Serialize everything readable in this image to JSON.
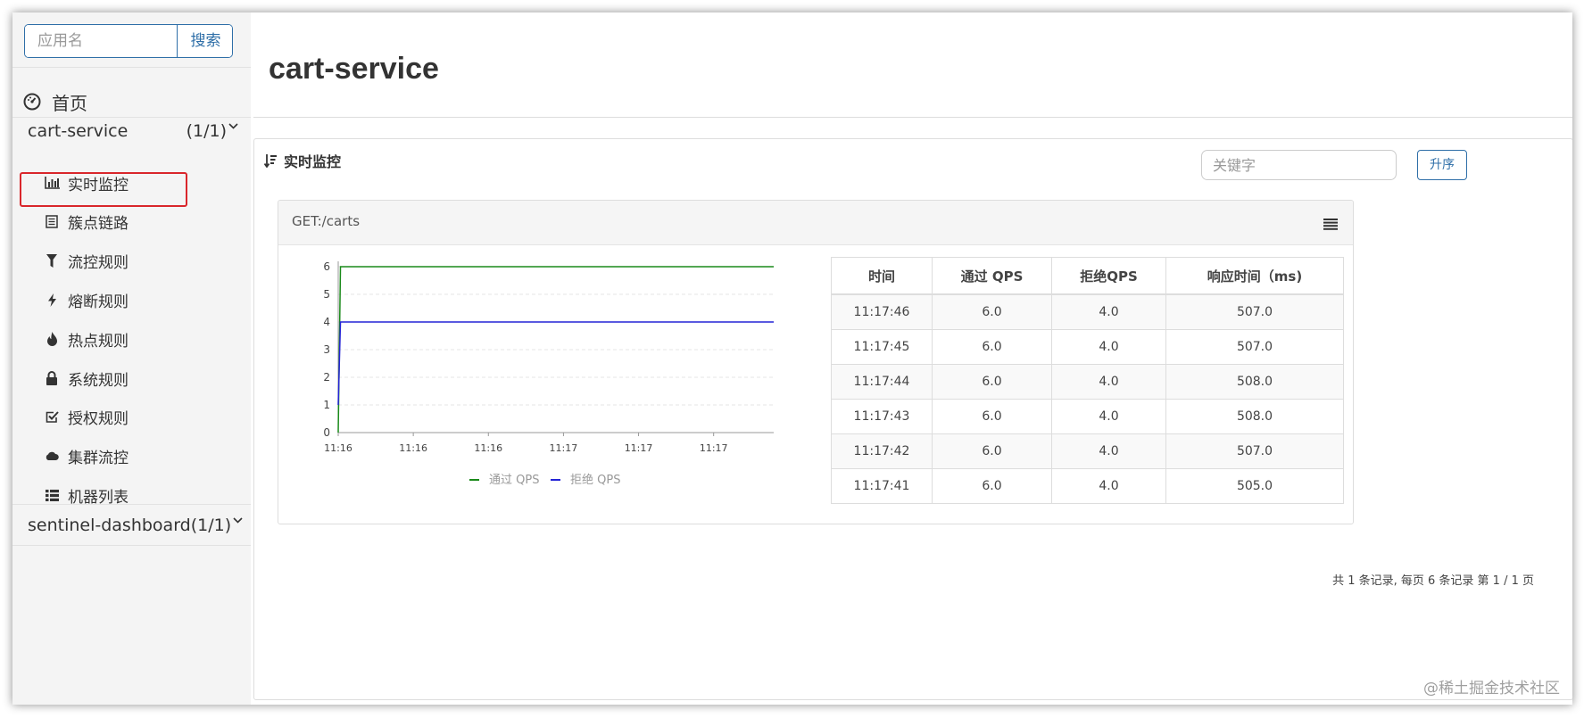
{
  "sidebar": {
    "search": {
      "placeholder": "应用名",
      "button_label": "搜索"
    },
    "home_label": "首页",
    "services": [
      {
        "name": "cart-service",
        "count": "(1/1)",
        "expanded": true,
        "items": [
          {
            "label": "实时监控",
            "icon": "bar-chart-icon",
            "selected": true
          },
          {
            "label": "簇点链路",
            "icon": "list-icon"
          },
          {
            "label": "流控规则",
            "icon": "filter-icon"
          },
          {
            "label": "熔断规则",
            "icon": "flash-icon"
          },
          {
            "label": "热点规则",
            "icon": "fire-icon"
          },
          {
            "label": "系统规则",
            "icon": "lock-icon"
          },
          {
            "label": "授权规则",
            "icon": "check-square-icon"
          },
          {
            "label": "集群流控",
            "icon": "cloud-icon"
          },
          {
            "label": "机器列表",
            "icon": "th-list-icon"
          }
        ]
      },
      {
        "name": "sentinel-dashboard",
        "count": "(1/1)",
        "expanded": false
      }
    ]
  },
  "main": {
    "title": "cart-service",
    "panel": {
      "title": "实时监控",
      "keyword_placeholder": "关键字",
      "sort_button": "升序",
      "resource": {
        "name": "GET:/carts",
        "table": {
          "headers": [
            "时间",
            "通过 QPS",
            "拒绝QPS",
            "响应时间（ms)"
          ],
          "rows": [
            [
              "11:17:46",
              "6.0",
              "4.0",
              "507.0"
            ],
            [
              "11:17:45",
              "6.0",
              "4.0",
              "507.0"
            ],
            [
              "11:17:44",
              "6.0",
              "4.0",
              "508.0"
            ],
            [
              "11:17:43",
              "6.0",
              "4.0",
              "508.0"
            ],
            [
              "11:17:42",
              "6.0",
              "4.0",
              "507.0"
            ],
            [
              "11:17:41",
              "6.0",
              "4.0",
              "505.0"
            ]
          ]
        }
      },
      "pagination": "共 1 条记录, 每页 6 条记录 第 1 / 1 页"
    }
  },
  "watermark": "@稀土掘金技术社区",
  "colors": {
    "primary": "#2f6fa8",
    "highlight": "#d9262b",
    "pass": "#1a8a1a",
    "block": "#2424d6"
  },
  "chart_data": {
    "type": "line",
    "x": [
      0,
      0.03,
      1.0,
      5.8
    ],
    "x_tick_labels": [
      "11:16",
      "11:16",
      "11:16",
      "11:17",
      "11:17",
      "11:17"
    ],
    "series": [
      {
        "name": "通过 QPS",
        "values": [
          0,
          6,
          6,
          6
        ],
        "color": "#1a8a1a"
      },
      {
        "name": "拒绝 QPS",
        "values": [
          1,
          4,
          4,
          4
        ],
        "color": "#2424d6"
      }
    ],
    "ylim": [
      0,
      6
    ],
    "y_ticks": [
      0,
      1,
      2,
      3,
      4,
      5,
      6
    ],
    "grid": true,
    "legend": "bottom"
  }
}
